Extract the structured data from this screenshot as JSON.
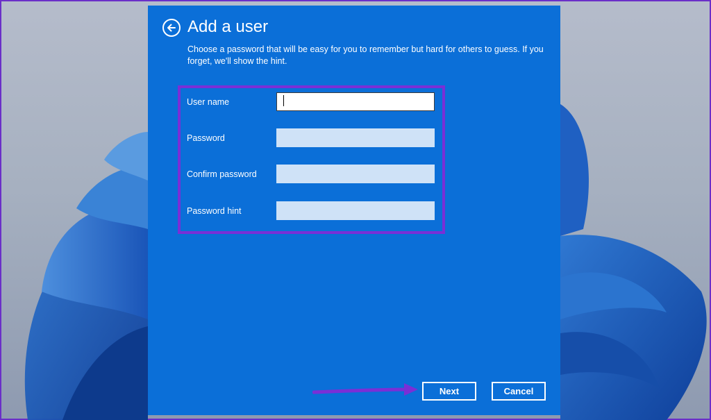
{
  "dialog": {
    "title": "Add a user",
    "description": "Choose a password that will be easy for you to remember but hard for others to guess. If you forget, we'll show the hint.",
    "back_icon": "back-arrow-icon"
  },
  "fields": [
    {
      "label": "User name",
      "value": "",
      "placeholder": ""
    },
    {
      "label": "Password",
      "value": "",
      "placeholder": ""
    },
    {
      "label": "Confirm password",
      "value": "",
      "placeholder": ""
    },
    {
      "label": "Password hint",
      "value": "",
      "placeholder": ""
    }
  ],
  "buttons": {
    "next": "Next",
    "cancel": "Cancel"
  },
  "annotation": {
    "highlight_color": "#7a2fd6",
    "arrow_color": "#7a2fd6"
  },
  "colors": {
    "dialog_background": "#0b6fd8",
    "inactive_input": "#cfe2f7",
    "active_input": "#ffffff"
  }
}
